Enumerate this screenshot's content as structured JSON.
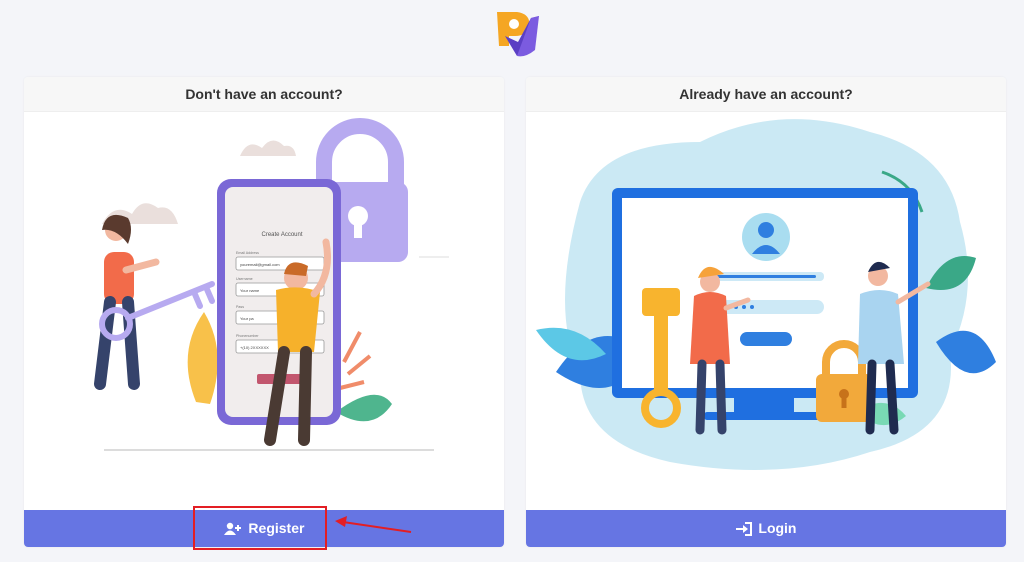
{
  "header": {
    "logo_icon": "brand-logo-icon"
  },
  "register_card": {
    "title": "Don't have an account?",
    "button_label": "Register",
    "button_icon": "user-plus-icon",
    "phone_form": {
      "heading": "Create Account",
      "fields": [
        {
          "label": "Email Address",
          "value": "youremail@gmail.com"
        },
        {
          "label": "Username",
          "value": "Your name"
        },
        {
          "label": "Pass",
          "value": "Your pa"
        },
        {
          "label": "Phonenumber",
          "value": "+(10) 2XXXXXX"
        }
      ]
    }
  },
  "login_card": {
    "title": "Already have an account?",
    "button_label": "Login",
    "button_icon": "sign-in-icon"
  },
  "colors": {
    "button": "#6675e3",
    "highlight": "#e31e24",
    "brand_orange": "#f5a623",
    "brand_purple": "#5b3fc4"
  }
}
